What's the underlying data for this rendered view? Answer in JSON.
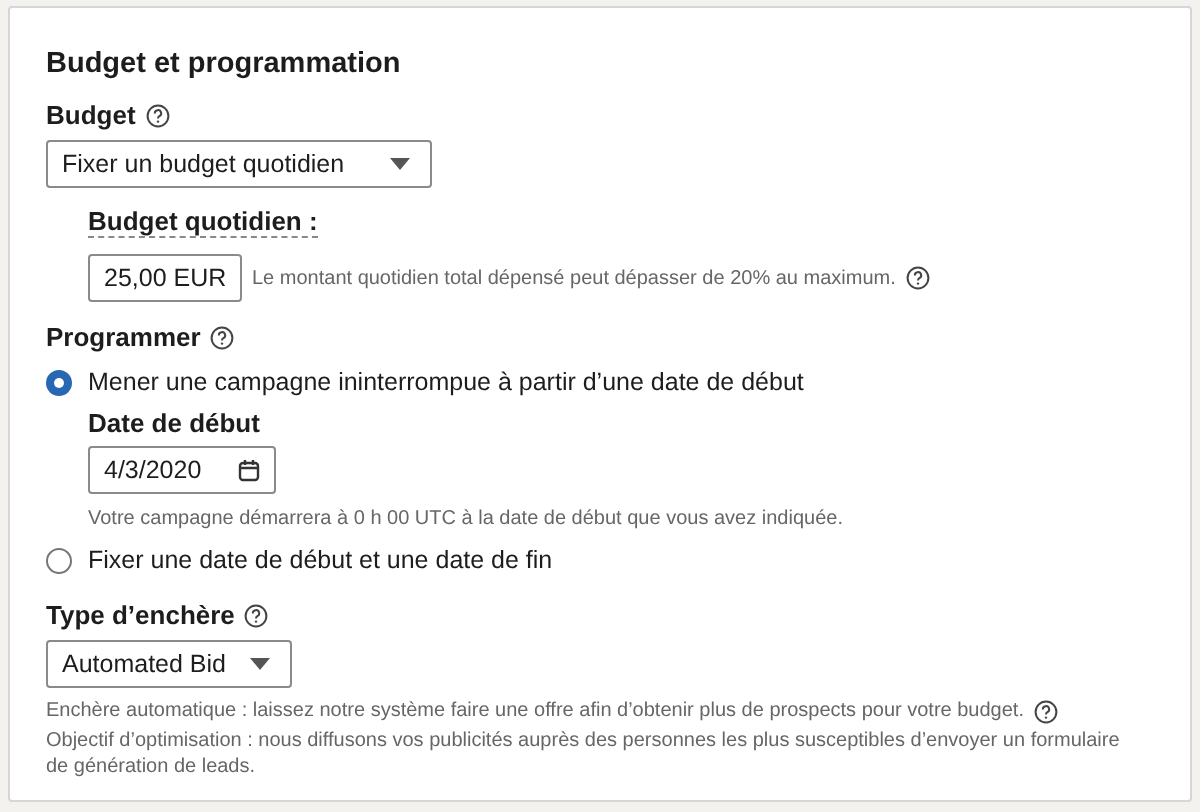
{
  "section": {
    "title": "Budget et programmation"
  },
  "budget": {
    "label": "Budget",
    "select": {
      "value": "Fixer un budget quotidien"
    },
    "daily": {
      "label": "Budget quotidien :",
      "value": "25,00 EUR",
      "hint": "Le montant quotidien total dépensé peut dépasser de 20% au maximum."
    }
  },
  "schedule": {
    "label": "Programmer",
    "options": [
      {
        "label": "Mener une campagne ininterrompue à partir d’une date de début",
        "selected": true,
        "start_date": {
          "label": "Date de début",
          "value": "4/3/2020",
          "hint": "Votre campagne démarrera à 0 h 00 UTC à la date de début que vous avez indiquée."
        }
      },
      {
        "label": "Fixer une date de début et une date de fin",
        "selected": false
      }
    ]
  },
  "bidding": {
    "label": "Type d’enchère",
    "select": {
      "value": "Automated Bid"
    },
    "notes": [
      "Enchère automatique : laissez notre système faire une offre afin d’obtenir plus de prospects pour votre budget.",
      "Objectif d’optimisation : nous diffusons vos publicités auprès des personnes les plus susceptibles d’envoyer un formulaire de génération de leads."
    ]
  }
}
